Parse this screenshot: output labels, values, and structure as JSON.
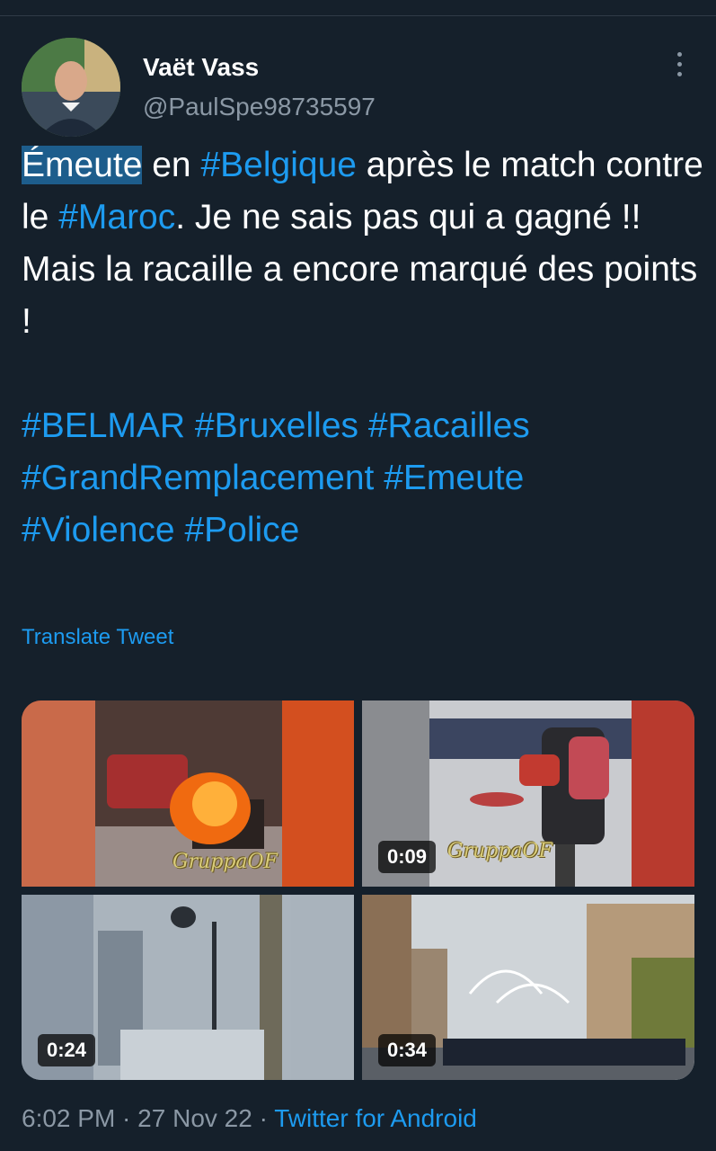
{
  "author": {
    "display_name": "Vaët Vass",
    "handle": "@PaulSpe98735597"
  },
  "tweet": {
    "line1_highlight": "Émeute",
    "line1_a": " en ",
    "line1_tag1": "#Belgique",
    "line1_b": " après le match contre le ",
    "line1_tag2": "#Maroc",
    "line1_c": ". Je ne sais pas qui a gagné !!",
    "line2": "Mais la racaille a encore marqué des points !",
    "hashtags": [
      "#BELMAR",
      "#Bruxelles",
      "#Racailles",
      "#GrandRemplacement",
      "#Emeute",
      "#Violence",
      "#Police"
    ]
  },
  "translate_label": "Translate Tweet",
  "media": [
    {
      "duration": "",
      "watermark": "GruppaOF"
    },
    {
      "duration": "0:09",
      "watermark": "GruppaOF"
    },
    {
      "duration": "0:24",
      "watermark": ""
    },
    {
      "duration": "0:34",
      "watermark": ""
    }
  ],
  "footer": {
    "time": "6:02 PM",
    "sep1": " · ",
    "date": "27 Nov 22",
    "sep2": " · ",
    "source": "Twitter for Android"
  },
  "colors": {
    "background": "#15202b",
    "link": "#1d9bf0",
    "secondary_text": "#8b98a5"
  },
  "icons": [
    "more-options-icon"
  ]
}
